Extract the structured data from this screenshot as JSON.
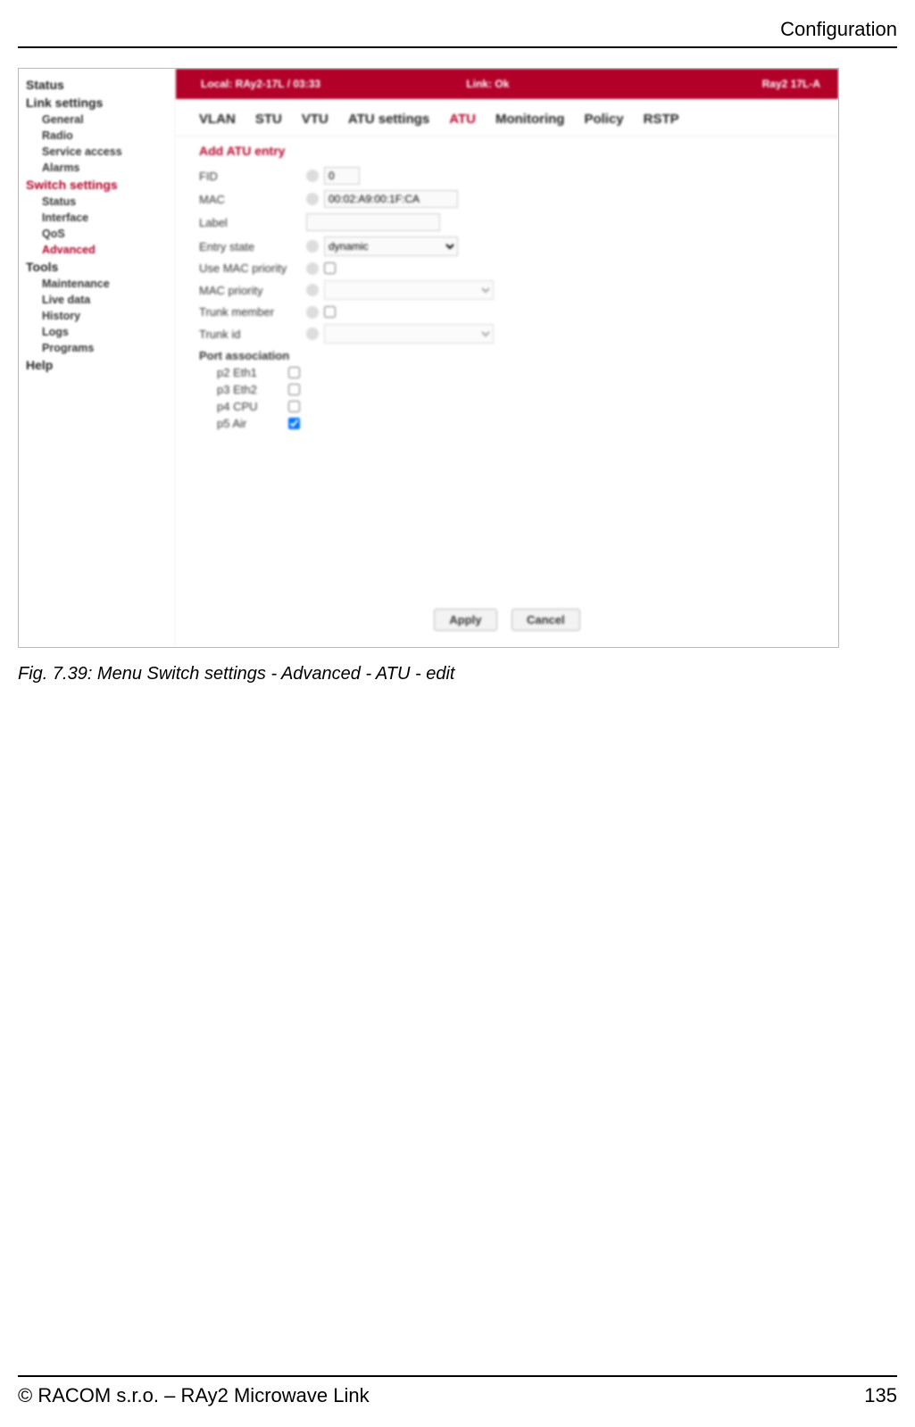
{
  "doc": {
    "header_right": "Configuration",
    "caption": "Fig. 7.39: Menu Switch settings - Advanced - ATU - edit",
    "footer_left": "© RACOM s.r.o. – RAy2 Microwave Link",
    "footer_right": "135"
  },
  "sidebar": {
    "items": [
      {
        "label": "Status",
        "type": "top"
      },
      {
        "label": "Link settings",
        "type": "top"
      },
      {
        "label": "General",
        "type": "sub"
      },
      {
        "label": "Radio",
        "type": "sub"
      },
      {
        "label": "Service access",
        "type": "sub"
      },
      {
        "label": "Alarms",
        "type": "sub"
      },
      {
        "label": "Switch settings",
        "type": "top-active"
      },
      {
        "label": "Status",
        "type": "sub"
      },
      {
        "label": "Interface",
        "type": "sub"
      },
      {
        "label": "QoS",
        "type": "sub"
      },
      {
        "label": "Advanced",
        "type": "sub-active"
      },
      {
        "label": "Tools",
        "type": "top"
      },
      {
        "label": "Maintenance",
        "type": "sub"
      },
      {
        "label": "Live data",
        "type": "sub"
      },
      {
        "label": "History",
        "type": "sub"
      },
      {
        "label": "Logs",
        "type": "sub"
      },
      {
        "label": "Programs",
        "type": "sub"
      },
      {
        "label": "Help",
        "type": "top"
      }
    ]
  },
  "redbar": {
    "left": "Local: RAy2-17L / 03:33",
    "mid": "Link: Ok",
    "right": "Ray2 17L-A"
  },
  "tabs": {
    "items": [
      {
        "label": "VLAN",
        "active": false
      },
      {
        "label": "STU",
        "active": false
      },
      {
        "label": "VTU",
        "active": false
      },
      {
        "label": "ATU settings",
        "active": false
      },
      {
        "label": "ATU",
        "active": true
      },
      {
        "label": "Monitoring",
        "active": false
      },
      {
        "label": "Policy",
        "active": false
      },
      {
        "label": "RSTP",
        "active": false
      }
    ]
  },
  "form": {
    "title": "Add ATU entry",
    "fid_label": "FID",
    "fid_value": "0",
    "mac_label": "MAC",
    "mac_value": "00:02:A9:00:1F:CA",
    "label_label": "Label",
    "label_value": "",
    "entry_state_label": "Entry state",
    "entry_state_value": "dynamic",
    "use_fpri_label": "Use MAC priority",
    "mac_priority_label": "MAC priority",
    "mac_priority_value": "",
    "trunk_member_label": "Trunk member",
    "trunk_id_label": "Trunk id",
    "trunk_id_value": "",
    "port_assoc_label": "Port association",
    "ports": [
      {
        "label": "p2 Eth1",
        "checked": false
      },
      {
        "label": "p3 Eth2",
        "checked": false
      },
      {
        "label": "p4 CPU",
        "checked": false
      },
      {
        "label": "p5 Air",
        "checked": true
      }
    ],
    "apply": "Apply",
    "cancel": "Cancel"
  }
}
